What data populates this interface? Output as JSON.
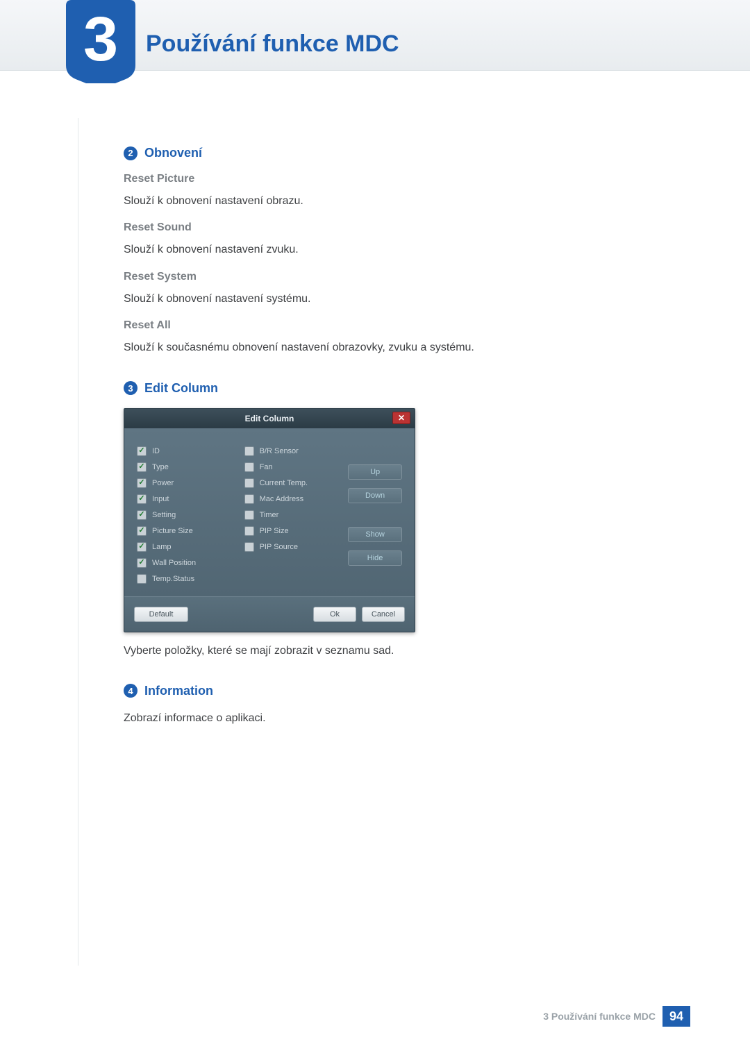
{
  "header": {
    "chapter_number": "3",
    "chapter_title": "Používání funkce MDC"
  },
  "sections": {
    "s2": {
      "num": "2",
      "title": "Obnovení",
      "items": [
        {
          "heading": "Reset Picture",
          "text": "Slouží k obnovení nastavení obrazu."
        },
        {
          "heading": "Reset Sound",
          "text": "Slouží k obnovení nastavení zvuku."
        },
        {
          "heading": "Reset System",
          "text": "Slouží k obnovení nastavení systému."
        },
        {
          "heading": "Reset All",
          "text": "Slouží k současnému obnovení nastavení obrazovky, zvuku a systému."
        }
      ]
    },
    "s3": {
      "num": "3",
      "title": "Edit Column",
      "caption": "Vyberte položky, které se mají zobrazit v seznamu sad."
    },
    "s4": {
      "num": "4",
      "title": "Information",
      "text": "Zobrazí informace o aplikaci."
    }
  },
  "dialog": {
    "title": "Edit Column",
    "left": [
      {
        "label": "ID",
        "checked": true
      },
      {
        "label": "Type",
        "checked": true
      },
      {
        "label": "Power",
        "checked": true
      },
      {
        "label": "Input",
        "checked": true
      },
      {
        "label": "Setting",
        "checked": true
      },
      {
        "label": "Picture Size",
        "checked": true
      },
      {
        "label": "Lamp",
        "checked": true
      },
      {
        "label": "Wall Position",
        "checked": true
      },
      {
        "label": "Temp.Status",
        "checked": false
      }
    ],
    "mid": [
      {
        "label": "B/R Sensor",
        "checked": false
      },
      {
        "label": "Fan",
        "checked": false
      },
      {
        "label": "Current Temp.",
        "checked": false
      },
      {
        "label": "Mac Address",
        "checked": false
      },
      {
        "label": "Timer",
        "checked": false
      },
      {
        "label": "PIP Size",
        "checked": false
      },
      {
        "label": "PIP Source",
        "checked": false
      }
    ],
    "side_buttons": {
      "up": "Up",
      "down": "Down",
      "show": "Show",
      "hide": "Hide"
    },
    "footer": {
      "default": "Default",
      "ok": "Ok",
      "cancel": "Cancel"
    }
  },
  "footer": {
    "text": "3 Používání funkce MDC",
    "page": "94"
  }
}
